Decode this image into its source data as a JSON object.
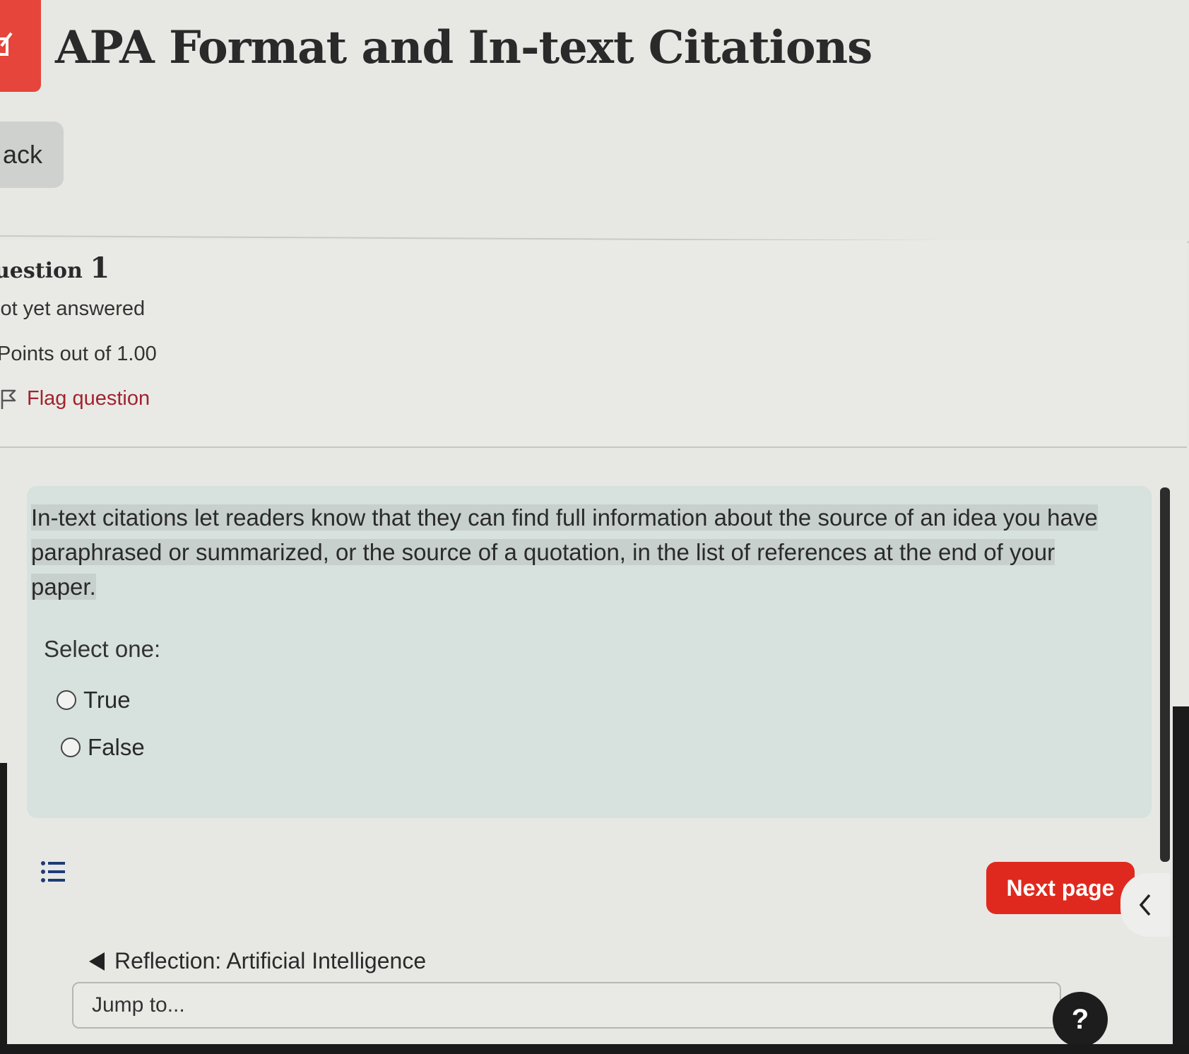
{
  "header": {
    "title": "APA Format and In-text Citations",
    "badge_color": "#e5453a"
  },
  "back_button": {
    "label": "ack"
  },
  "question_info": {
    "title_word": "uestion",
    "number": "1",
    "status": "lot yet answered",
    "points": "Points out of 1.00",
    "flag_label": "Flag question",
    "flag_icon": "flag-outline-icon"
  },
  "question": {
    "text_lines": [
      "In-text citations let readers know that they can find full information about the source of an idea you have",
      "paraphrased or summarized, or the source of a quotation, in the list of references at the end of your",
      "paper."
    ],
    "select_prompt": "Select one:",
    "options": [
      {
        "label": "True",
        "selected": false
      },
      {
        "label": "False",
        "selected": false
      }
    ]
  },
  "navigation": {
    "list_icon": "list-icon",
    "next_label": "Next page",
    "next_color": "#e0291e",
    "drawer_icon": "chevron-left-icon",
    "prev_activity": "Reflection: Artificial Intelligence",
    "jump_placeholder": "Jump to...",
    "help_label": "?"
  }
}
